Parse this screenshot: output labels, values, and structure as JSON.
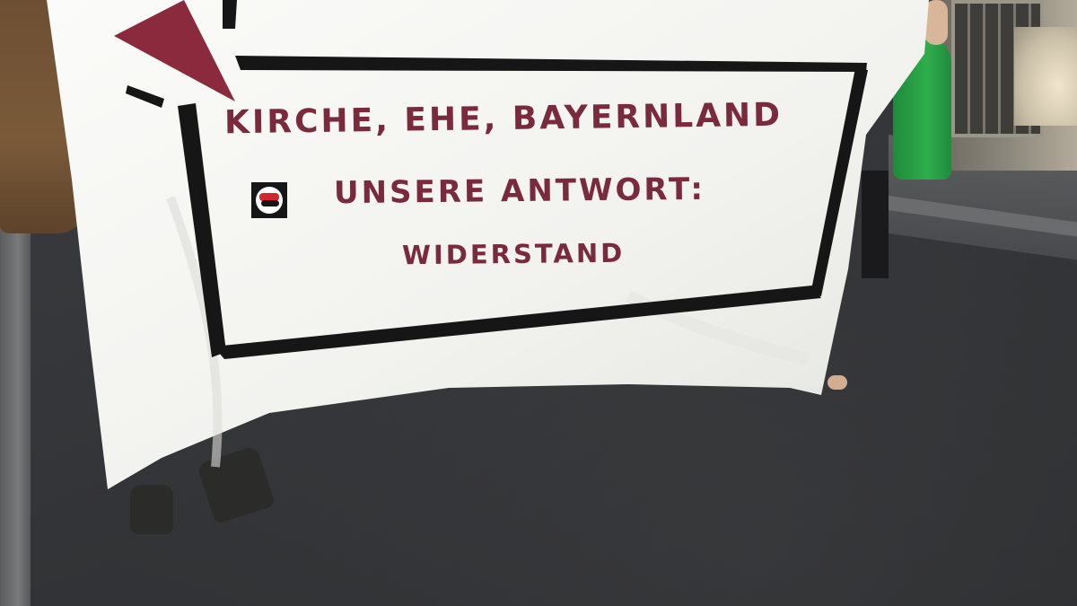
{
  "banner": {
    "line1": "KIRCHE, EHE, BAYERNLAND",
    "line2": "UNSERE ANTWORT:",
    "line3": "WIDERSTAND",
    "text_color": "#7a2a3d",
    "cloth_color": "#f4f4f2",
    "frame_color": "#161616",
    "accent_triangle_color": "#8a2a3c"
  },
  "icons": {
    "badge": "antifa-flag-icon"
  }
}
